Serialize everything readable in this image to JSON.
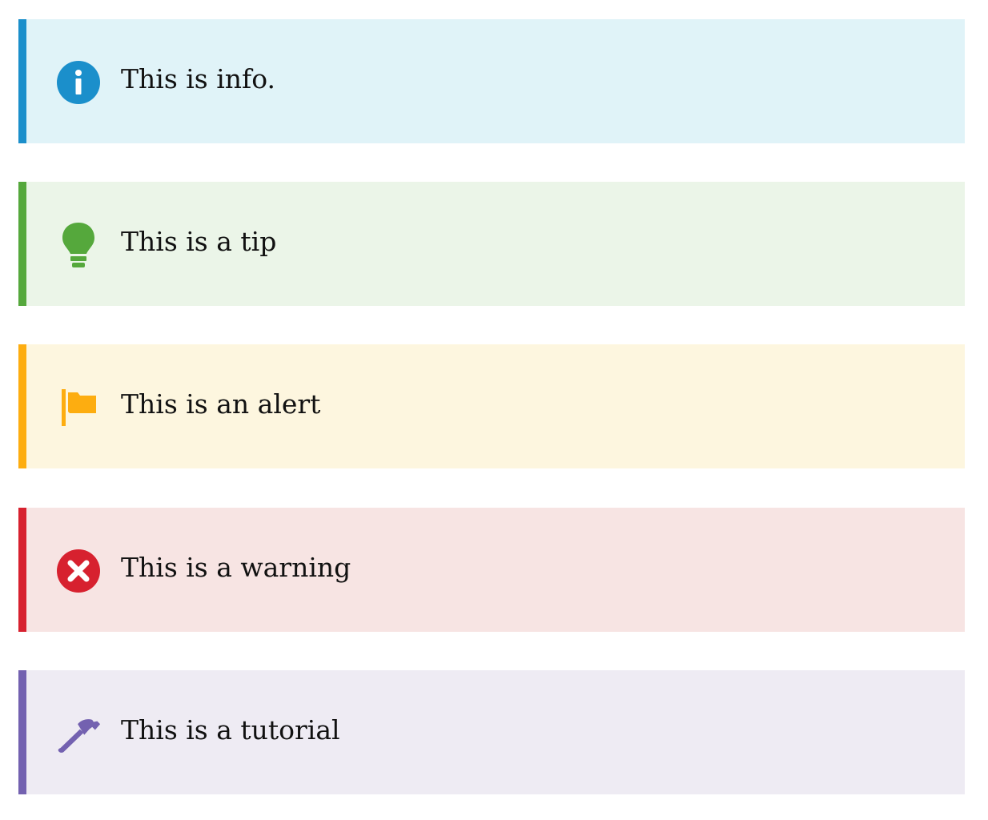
{
  "callouts": [
    {
      "id": "info",
      "text": "This is info.",
      "icon": "info-circle-icon",
      "accent": "#1b8fcb",
      "background": "#e0f3f8"
    },
    {
      "id": "tip",
      "text": "This is a tip",
      "icon": "lightbulb-icon",
      "accent": "#55a83c",
      "background": "#ebf5e8"
    },
    {
      "id": "alert",
      "text": "This is an alert",
      "icon": "flag-icon",
      "accent": "#fdad10",
      "background": "#fdf6df"
    },
    {
      "id": "warning",
      "text": "This is a warning",
      "icon": "x-circle-icon",
      "accent": "#d7212f",
      "background": "#f7e4e3"
    },
    {
      "id": "tutorial",
      "text": "This is a tutorial",
      "icon": "hammer-icon",
      "accent": "#7361b0",
      "background": "#eeebf3"
    }
  ]
}
